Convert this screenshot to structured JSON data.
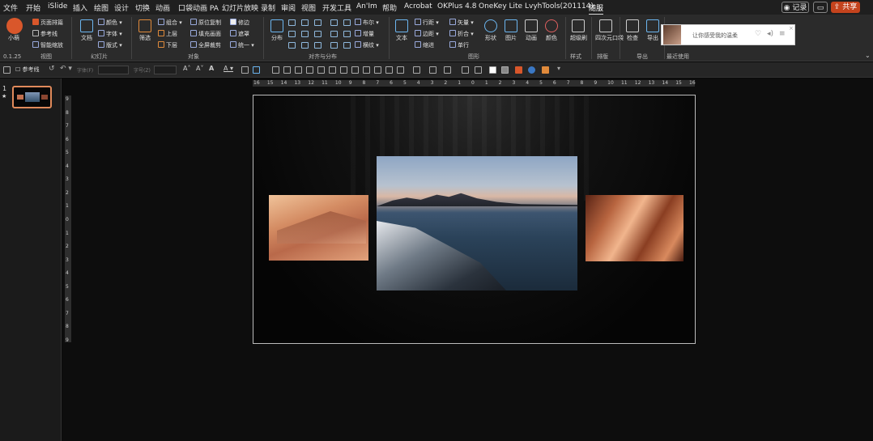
{
  "menu": {
    "items": [
      "文件",
      "开始",
      "iSlide",
      "插入",
      "绘图",
      "设计",
      "切换",
      "动画",
      "口袋动画 PA",
      "幻灯片放映",
      "录制",
      "审阅",
      "视图",
      "开发工具",
      "An'Im",
      "帮助",
      "Acrobat",
      "OKPlus 4.8",
      "OneKey Lite",
      "LvyhTools(201114)",
      "随服"
    ],
    "active": "随服",
    "record_label": "记录",
    "share_label": "共享"
  },
  "ribbon": {
    "groups": {
      "view": "视图",
      "slides": "幻灯片",
      "objects": "对象",
      "align": "对齐与分布",
      "graphics": "图形",
      "style": "样式",
      "layout": "排版",
      "export": "导出",
      "recent": "最近使用"
    },
    "version": "0.1.25",
    "small_mode": "小萌",
    "checks": [
      "页面排篇",
      "参考线",
      "智能缩放"
    ],
    "doc_label": "文档",
    "slide_opts": [
      "颜色",
      "字体",
      "版式"
    ],
    "filter_label": "筛选",
    "obj_cmds": [
      "组合",
      "上层",
      "下层"
    ],
    "obj_cmds2": [
      "原位复制",
      "填充画面",
      "全屏裁剪"
    ],
    "obj_cmds3": [
      "修边",
      "遮罩",
      "统一"
    ],
    "distribute_label": "分布",
    "align_cmds": [
      "布尔",
      "增量",
      "横纹"
    ],
    "text_label": "文本",
    "text_cmds": [
      "行距",
      "边距",
      "缩进"
    ],
    "vector_cmds": [
      "矢量",
      "折合",
      "单行"
    ],
    "shape_label": "形状",
    "pic_label": "图片",
    "anim_label": "动画",
    "color_label": "颜色",
    "superlevel_label": "超级刷",
    "fourgrid_label": "四次元口袋",
    "check_label": "检查",
    "export_label": "导出",
    "music_placeholder": "让你感受我的温柔"
  },
  "qat": {
    "guides_label": "参考线",
    "font_placeholder": "字体(F)",
    "size_placeholder": "字号(Z)"
  },
  "thumbnails": [
    {
      "num": "1",
      "star": "★"
    }
  ],
  "ruler": {
    "h_ticks": [
      "16",
      "15",
      "14",
      "13",
      "12",
      "11",
      "10",
      "9",
      "8",
      "7",
      "6",
      "5",
      "4",
      "3",
      "2",
      "1",
      "0",
      "1",
      "2",
      "3",
      "4",
      "5",
      "6",
      "7",
      "8",
      "9",
      "10",
      "11",
      "12",
      "13",
      "14",
      "15",
      "16"
    ],
    "v_ticks": [
      "9",
      "8",
      "7",
      "6",
      "5",
      "4",
      "3",
      "2",
      "1",
      "0",
      "1",
      "2",
      "3",
      "4",
      "5",
      "6",
      "7",
      "8",
      "9"
    ]
  },
  "colors": {
    "accent": "#d9572b",
    "share": "#c4431d",
    "ribbon_bg": "#2b2b2b",
    "slide_bg": "#050505"
  }
}
